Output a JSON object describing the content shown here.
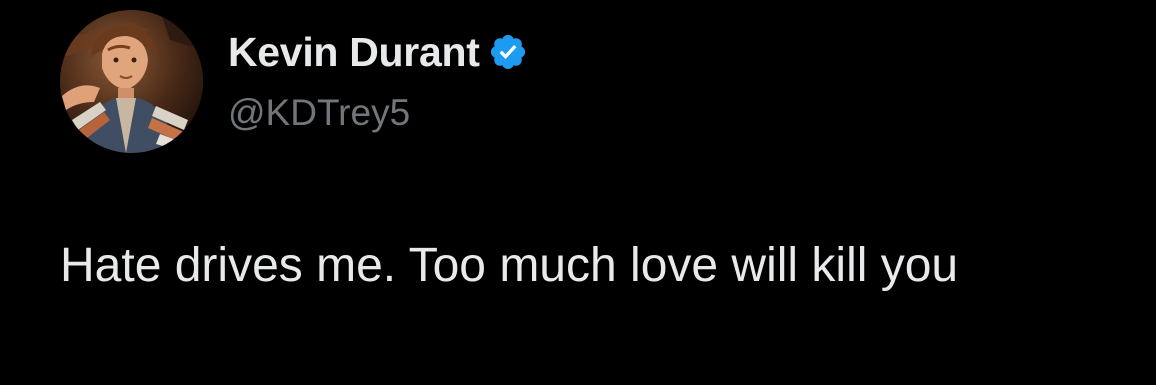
{
  "tweet": {
    "author": {
      "display_name": "Kevin Durant",
      "handle": "@KDTrey5",
      "verified": true,
      "avatar_icon": "profile-photo"
    },
    "text": "Hate drives me. Too much love will kill you"
  },
  "colors": {
    "background": "#000000",
    "primary_text": "#e7e9ea",
    "secondary_text": "#71767b",
    "verified_badge": "#1d9bf0"
  }
}
